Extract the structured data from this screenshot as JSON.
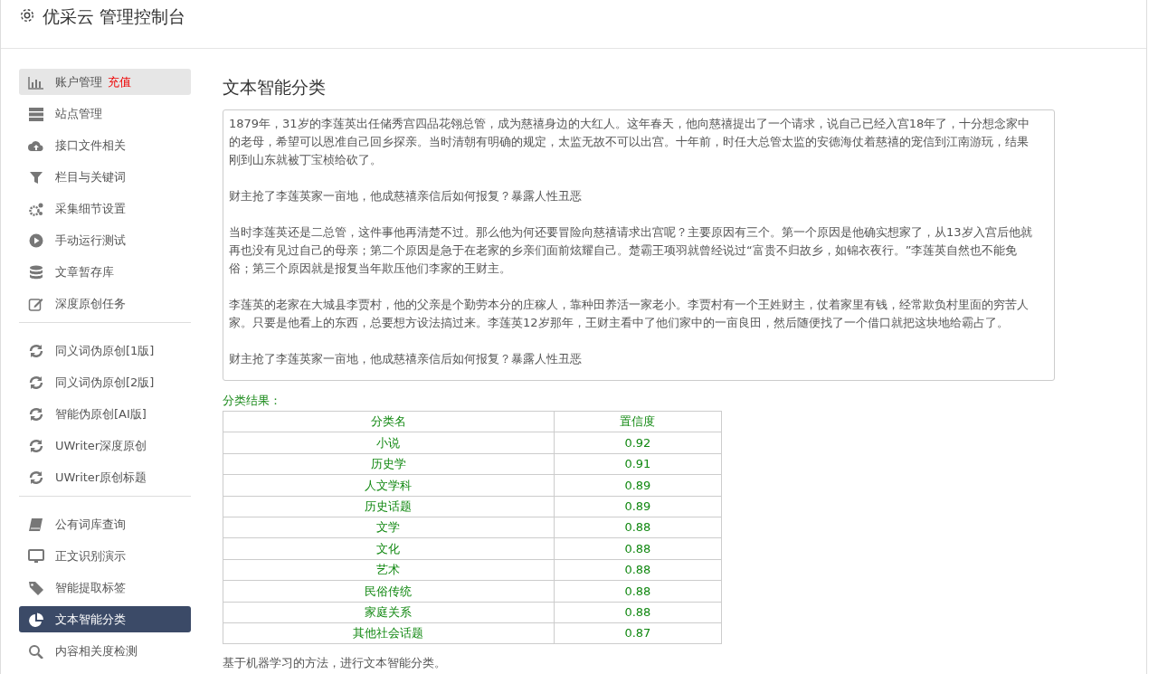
{
  "header": {
    "title": "优采云 管理控制台"
  },
  "sidebar": {
    "groups": [
      {
        "items": [
          {
            "label": "账户管理",
            "extra": "充值",
            "selected": false,
            "highlighted": true
          },
          {
            "label": "站点管理",
            "selected": false,
            "highlighted": false
          },
          {
            "label": "接口文件相关",
            "selected": false,
            "highlighted": false
          },
          {
            "label": "栏目与关键词",
            "selected": false,
            "highlighted": false
          },
          {
            "label": "采集细节设置",
            "selected": false,
            "highlighted": false
          },
          {
            "label": "手动运行测试",
            "selected": false,
            "highlighted": false
          },
          {
            "label": "文章暂存库",
            "selected": false,
            "highlighted": false
          },
          {
            "label": "深度原创任务",
            "selected": false,
            "highlighted": false
          }
        ]
      },
      {
        "items": [
          {
            "label": "同义词伪原创[1版]",
            "selected": false,
            "highlighted": false
          },
          {
            "label": "同义词伪原创[2版]",
            "selected": false,
            "highlighted": false
          },
          {
            "label": "智能伪原创[AI版]",
            "selected": false,
            "highlighted": false
          },
          {
            "label": "UWriter深度原创",
            "selected": false,
            "highlighted": false
          },
          {
            "label": "UWriter原创标题",
            "selected": false,
            "highlighted": false
          }
        ]
      },
      {
        "items": [
          {
            "label": "公有词库查询",
            "selected": false,
            "highlighted": false
          },
          {
            "label": "正文识别演示",
            "selected": false,
            "highlighted": false
          },
          {
            "label": "智能提取标签",
            "selected": false,
            "highlighted": false
          },
          {
            "label": "文本智能分类",
            "selected": true,
            "highlighted": false
          },
          {
            "label": "内容相关度检测",
            "selected": false,
            "highlighted": false
          }
        ]
      }
    ]
  },
  "main": {
    "heading": "文本智能分类",
    "text_input": {
      "paragraphs": [
        "1879年，31岁的李莲英出任储秀宫四品花翎总管，成为慈禧身边的大红人。这年春天，他向慈禧提出了一个请求，说自己已经入宫18年了，十分想念家中的老母，希望可以恩准自己回乡探亲。当时清朝有明确的规定，太监无故不可以出宫。十年前，时任大总管太监的安德海仗着慈禧的宠信到江南游玩，结果刚到山东就被丁宝桢给砍了。",
        "财主抢了李莲英家一亩地，他成慈禧亲信后如何报复？暴露人性丑恶",
        "当时李莲英还是二总管，这件事他再清楚不过。那么他为何还要冒险向慈禧请求出宫呢？主要原因有三个。第一个原因是他确实想家了，从13岁入宫后他就再也没有见过自己的母亲；第二个原因是急于在老家的乡亲们面前炫耀自己。楚霸王项羽就曾经说过“富贵不归故乡，如锦衣夜行。”李莲英自然也不能免俗；第三个原因就是报复当年欺压他们李家的王财主。",
        "李莲英的老家在大城县李贾村，他的父亲是个勤劳本分的庄稼人，靠种田养活一家老小。李贾村有一个王姓财主，仗着家里有钱，经常欺负村里面的穷苦人家。只要是他看上的东西，总要想方设法搞过来。李莲英12岁那年，王财主看中了他们家中的一亩良田，然后随便找了一个借口就把这块地给霸占了。",
        "财主抢了李莲英家一亩地，他成慈禧亲信后如何报复？暴露人性丑恶"
      ]
    },
    "result_label": "分类结果：",
    "table": {
      "columns": [
        "分类名",
        "置信度"
      ],
      "rows": [
        [
          "小说",
          "0.92"
        ],
        [
          "历史学",
          "0.91"
        ],
        [
          "人文学科",
          "0.89"
        ],
        [
          "历史话题",
          "0.89"
        ],
        [
          "文学",
          "0.88"
        ],
        [
          "文化",
          "0.88"
        ],
        [
          "艺术",
          "0.88"
        ],
        [
          "民俗传统",
          "0.88"
        ],
        [
          "家庭关系",
          "0.88"
        ],
        [
          "其他社会话题",
          "0.87"
        ]
      ]
    },
    "footnote": "基于机器学习的方法，进行文本智能分类。"
  }
}
